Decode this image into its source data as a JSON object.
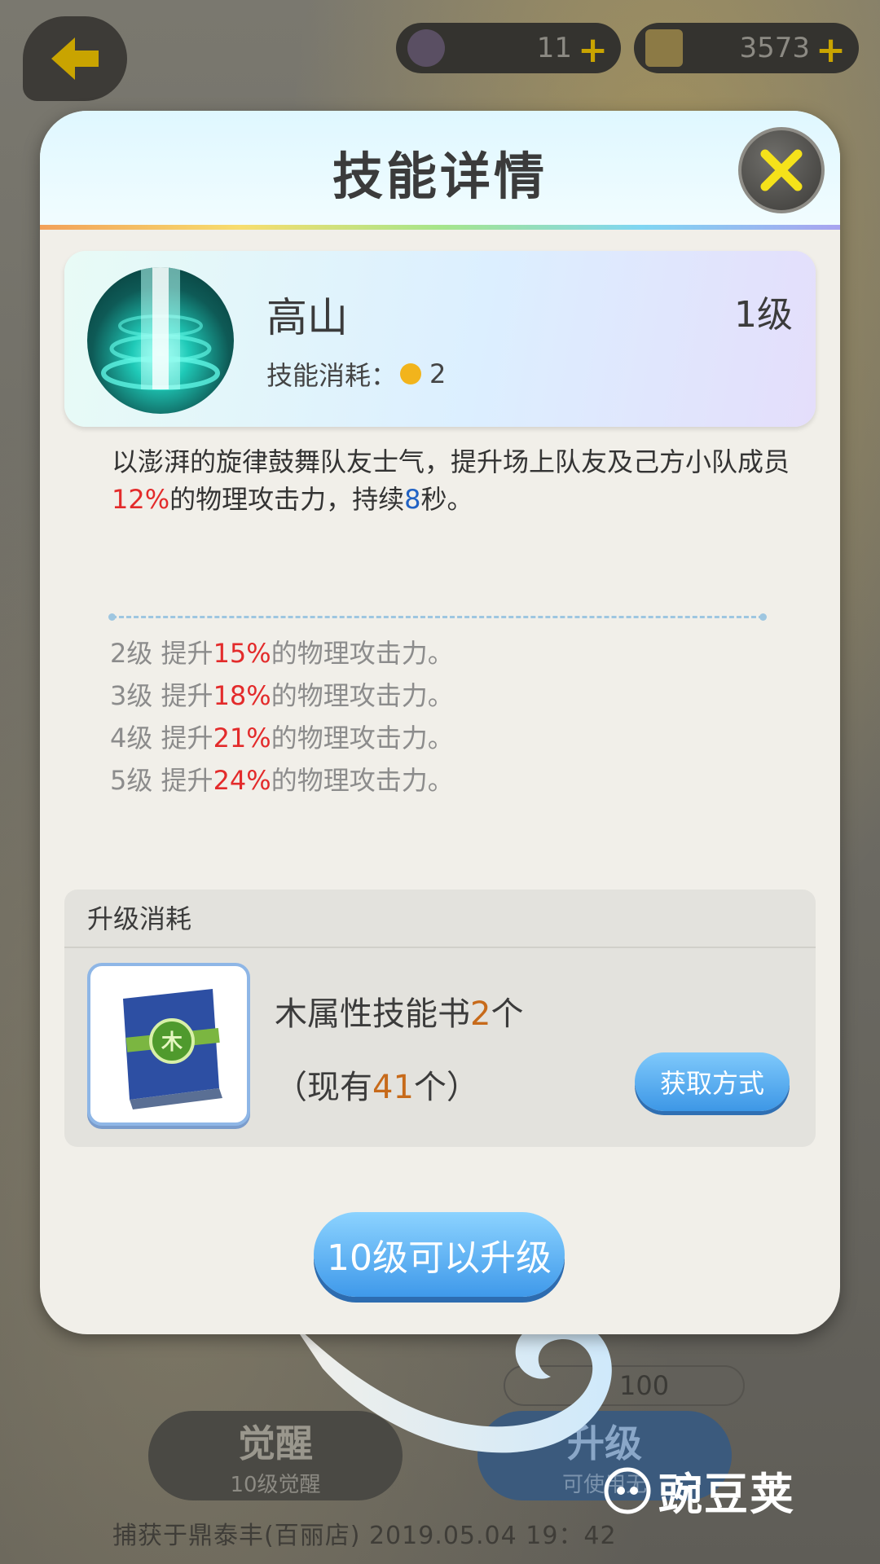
{
  "background": {
    "gem_count": "11",
    "gold_count": "3573",
    "cost_value": "100",
    "awaken_button": {
      "label": "觉醒",
      "sub": "10级觉醒"
    },
    "upgrade_button": {
      "label": "升级",
      "sub": "可使用无"
    },
    "capture_info": "捕获于鼎泰丰(百丽店) 2019.05.04 19：42"
  },
  "modal": {
    "title": "技能详情",
    "skill": {
      "name": "高山",
      "level": "1级",
      "cost_label": "技能消耗：",
      "cost_value": "2"
    },
    "description": {
      "part1": "以澎湃的旋律鼓舞队友士气，提升场上队友及己方小队成员",
      "pct": "12%",
      "part2": "的物理攻击力，持续",
      "seconds": "8",
      "part3": "秒。"
    },
    "level_ups": [
      {
        "level": "2级",
        "pre": "提升",
        "pct": "15%",
        "post": "的物理攻击力。"
      },
      {
        "level": "3级",
        "pre": "提升",
        "pct": "18%",
        "post": "的物理攻击力。"
      },
      {
        "level": "4级",
        "pre": "提升",
        "pct": "21%",
        "post": "的物理攻击力。"
      },
      {
        "level": "5级",
        "pre": "提升",
        "pct": "24%",
        "post": "的物理攻击力。"
      }
    ],
    "upgrade_cost": {
      "heading": "升级消耗",
      "item_name": "木属性技能书",
      "item_count": "2",
      "item_unit": "个",
      "have_prefix": "（现有",
      "have_count": "41",
      "have_suffix": "个）",
      "get_button": "获取方式"
    },
    "main_button": "10级可以升级"
  },
  "watermark": "豌豆荚",
  "colors": {
    "highlight_red": "#e32b2b",
    "highlight_blue": "#2162c4",
    "count_orange": "#c76a1a",
    "button_blue": "#3f99ea"
  }
}
